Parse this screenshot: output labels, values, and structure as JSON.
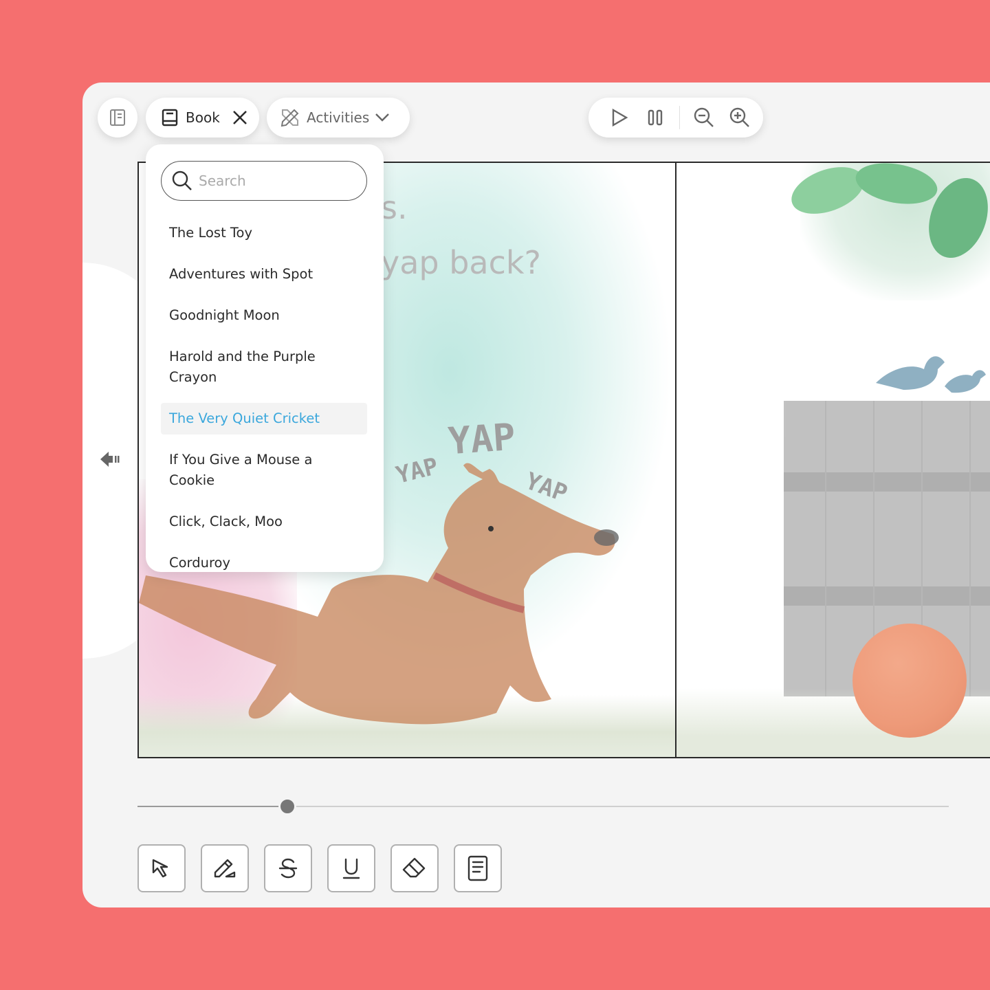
{
  "toolbar": {
    "book_label": "Book",
    "activities_label": "Activities"
  },
  "search": {
    "placeholder": "Search"
  },
  "book_list": {
    "items": [
      "The Lost Toy",
      "Adventures with Spot",
      "Goodnight Moon",
      "Harold and the Purple Crayon",
      "The Very Quiet Cricket",
      "If You Give a Mouse a Cookie",
      "Click, Clack, Moo",
      "Corduroy"
    ],
    "selected": "The Very Quiet Cricket"
  },
  "page": {
    "text_line1": "s.",
    "text_line2": "yap back?",
    "sound_words": [
      "YAP",
      "YAP",
      "YAP"
    ]
  },
  "progress": {
    "fraction": 0.185
  },
  "icons": {
    "toc": "table-of-contents-icon",
    "book": "book-icon",
    "close": "close-icon",
    "activities": "pencil-ruler-icon",
    "chevron": "chevron-down-icon",
    "play": "play-icon",
    "pause": "pause-icon",
    "zoom_out": "zoom-out-icon",
    "zoom_in": "zoom-in-icon",
    "prev": "previous-page-icon",
    "select": "select-cursor-icon",
    "highlight": "highlight-pen-icon",
    "strikethrough": "strikethrough-icon",
    "underline": "underline-icon",
    "eraser": "eraser-icon",
    "notes": "notes-icon"
  },
  "colors": {
    "background": "#f56f6f",
    "selected_text": "#3aa7dc",
    "panel": "#f4f4f4"
  }
}
